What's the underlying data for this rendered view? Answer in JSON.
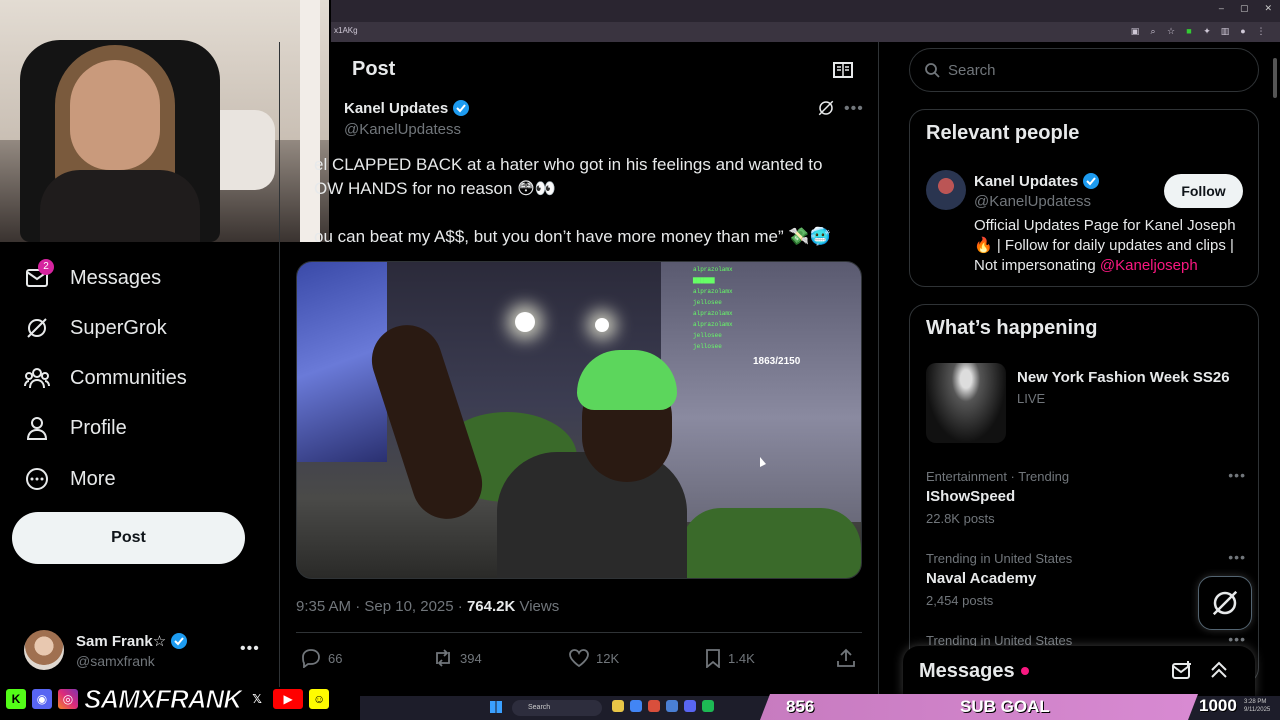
{
  "browser": {
    "url_fragment": "x1AKg"
  },
  "nav": {
    "messages_badge": "2",
    "items": [
      {
        "label": "Messages",
        "icon": "mail-icon"
      },
      {
        "label": "SuperGrok",
        "icon": "grok-icon"
      },
      {
        "label": "Communities",
        "icon": "people-icon"
      },
      {
        "label": "Profile",
        "icon": "person-icon"
      },
      {
        "label": "More",
        "icon": "more-circle-icon"
      }
    ],
    "post_button": "Post",
    "account": {
      "name": "Sam Frank☆",
      "handle": "@samxfrank"
    }
  },
  "main": {
    "header_title": "Post",
    "author": {
      "name": "Kanel Updates",
      "handle": "@KanelUpdatess"
    },
    "text_line1": "el CLAPPED BACK at a hater who got in his feelings and wanted to",
    "text_line2": "OW HANDS for no reason 😳👀",
    "text_line3": "ou can beat my A$$, but you don’t have more money than me” 💸🥶",
    "media": {
      "counter": "1863/2150"
    },
    "meta": {
      "time": "9:35 AM · Sep 10, 2025 · ",
      "views_count": "764.2K",
      "views_label": " Views"
    },
    "actions": {
      "replies": "66",
      "reposts": "394",
      "likes": "12K",
      "bookmarks": "1.4K"
    }
  },
  "sidebar": {
    "search_placeholder": "Search",
    "relevant": {
      "title": "Relevant people",
      "name": "Kanel Updates",
      "handle": "@KanelUpdatess",
      "follow": "Follow",
      "bio": "Official Updates Page for Kanel Joseph 🔥 | Follow for daily updates and clips | Not impersonating ",
      "bio_mention": "@Kaneljoseph"
    },
    "happening": {
      "title": "What’s happening",
      "featured": {
        "title": "New York Fashion Week SS26",
        "status": "LIVE"
      },
      "trends": [
        {
          "category": "Entertainment · Trending",
          "name": "IShowSpeed",
          "count": "22.8K posts"
        },
        {
          "category": "Trending in United States",
          "name": "Naval Academy",
          "count": "2,454 posts"
        },
        {
          "category": "Trending in United States",
          "name": "",
          "count": ""
        }
      ]
    },
    "messages_dock": "Messages"
  },
  "overlay": {
    "streamer_name": "SAMXFRANK",
    "sub_goal": {
      "current": "856",
      "label": "SUB GOAL",
      "target": "1000"
    },
    "taskbar_search": "Search",
    "clock": "3:28 PM\n9/11/2025"
  },
  "colors": {
    "accent_blue": "#1d9bf0",
    "mention_pink": "#f91880",
    "goal_pink": "#d88ad2"
  }
}
